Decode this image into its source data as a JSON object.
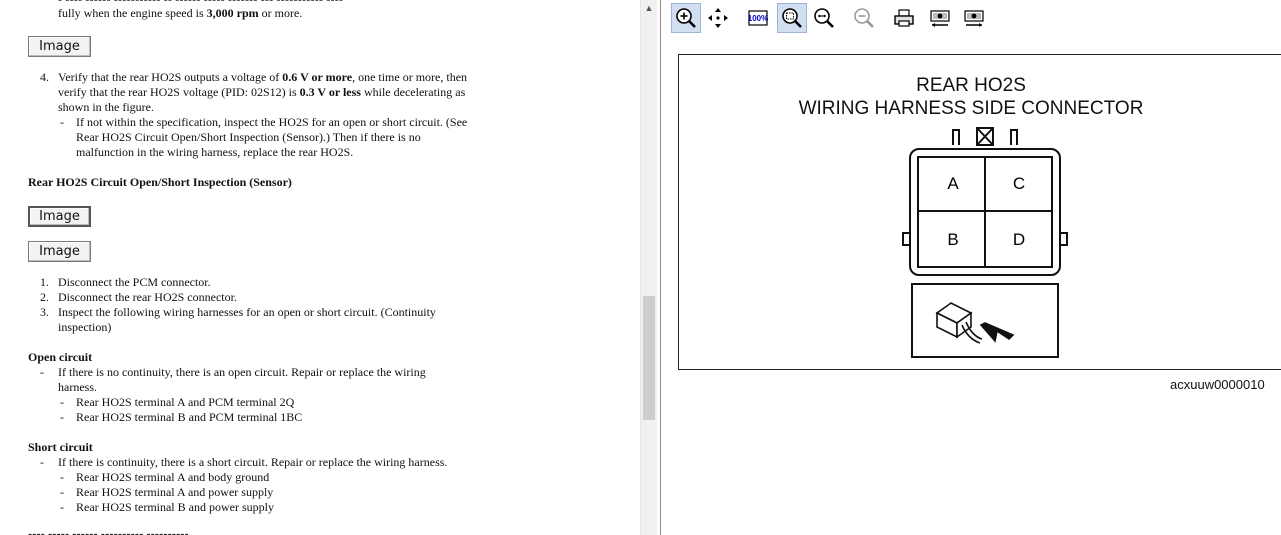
{
  "document": {
    "top_fragment_line": "fully when the engine speed is",
    "top_fragment_bold": "3,000 rpm",
    "top_fragment_end": "or more.",
    "image_button_label": "Image",
    "step4": {
      "number": "4.",
      "line1_a": "Verify that the rear HO2S outputs a voltage of",
      "line1_b": "0.6 V or more",
      "line1_c": ", one time or more, then",
      "line2_a": "verify that the rear HO2S voltage (PID: 02S12) is",
      "line2_b": "0.3 V or less",
      "line2_c": "while decelerating as",
      "line3": "shown in the figure.",
      "sub_dash": "-",
      "sub1": "If not within the specification, inspect the HO2S for an open or short circuit. (See",
      "sub2": "Rear HO2S Circuit Open/Short Inspection (Sensor).) Then if there is no",
      "sub3": "malfunction in the wiring harness, replace the rear HO2S."
    },
    "section_heading": "Rear HO2S Circuit Open/Short Inspection (Sensor)",
    "steps": [
      {
        "number": "1.",
        "text": "Disconnect the PCM connector."
      },
      {
        "number": "2.",
        "text": "Disconnect the rear HO2S connector."
      },
      {
        "number": "3.",
        "text": "Inspect the following wiring harnesses for an open or short circuit. (Continuity"
      }
    ],
    "step3_cont": "inspection)",
    "open_circuit": {
      "heading": "Open circuit",
      "line1": "If there is no continuity, there is an open circuit. Repair or replace the wiring",
      "line2": "harness.",
      "items": [
        "Rear HO2S terminal A and PCM terminal 2Q",
        "Rear HO2S terminal B and PCM terminal 1BC"
      ]
    },
    "short_circuit": {
      "heading": "Short circuit",
      "line1": "If there is continuity, there is a short circuit. Repair or replace the wiring harness.",
      "items": [
        "Rear HO2S terminal A and body ground",
        "Rear HO2S terminal A and power supply",
        "Rear HO2S terminal B and power supply"
      ]
    },
    "dash": "-"
  },
  "toolbar": {
    "buttons": [
      "zoom-in",
      "pan",
      "fit-100",
      "zoom-window",
      "zoom-out-magnifier",
      "zoom-disabled",
      "print",
      "copy-image",
      "save-image"
    ],
    "fit_label": "100%",
    "accent": "#d2dff0"
  },
  "diagram": {
    "title_line1": "REAR HO2S",
    "title_line2": "WIRING HARNESS SIDE CONNECTOR",
    "terminals": [
      "A",
      "C",
      "B",
      "D"
    ],
    "caption": "acxuuw0000010"
  }
}
